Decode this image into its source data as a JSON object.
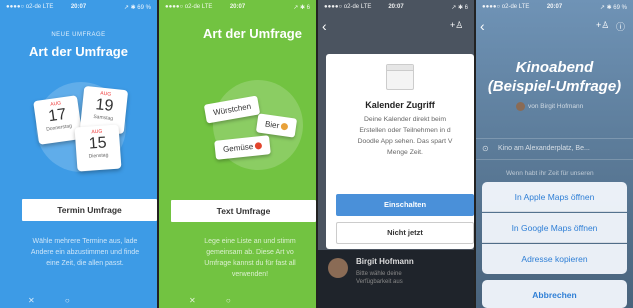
{
  "panel1": {
    "status": {
      "carrier": "●●●●○ o2-de  LTE",
      "time": "20:07",
      "battery": "↗ ✱ 69 %"
    },
    "overline": "NEUE UMFRAGE",
    "title": "Art der Umfrage",
    "cards": [
      {
        "month": "AUG",
        "day": "17",
        "weekday": "Donnerstag"
      },
      {
        "month": "AUG",
        "day": "19",
        "weekday": "Samstag"
      },
      {
        "month": "AUG",
        "day": "15",
        "weekday": "Dienstag"
      }
    ],
    "button": "Termin Umfrage",
    "desc": [
      "Wähle mehrere Termine aus, lade",
      "Andere ein abzustimmen und finde",
      "eine Zeit, die allen passt."
    ],
    "bg_color": "#3d9be6"
  },
  "panel2": {
    "status": {
      "carrier": "●●●●○ o2-de  LTE",
      "time": "20:07",
      "battery": "↗ ✱ 6"
    },
    "title": "Art der Umfrage",
    "tags": [
      "Würstchen",
      "Bier",
      "Gemüse"
    ],
    "button": "Text Umfrage",
    "desc": [
      "Lege eine Liste an und stimm",
      "gemeinsam ab. Diese Art vo",
      "Umfrage kannst du für fast all",
      "verwenden!"
    ],
    "bg_color": "#72c341"
  },
  "panel3": {
    "status": {
      "carrier": "●●●●○ o2-de  LTE",
      "time": "20:07",
      "battery": "↗ ✱ 6"
    },
    "dialog_title": "Kalender Zugriff",
    "dialog_text": [
      "Deine Kalender direkt beim",
      "Erstellen oder Teilnehmen in d",
      "Doodle App sehen. Das spart V",
      "Menge Zeit."
    ],
    "primary": "Einschalten",
    "secondary": "Nicht jetzt",
    "participant_name": "Birgit Hofmann",
    "participant_sub": [
      "Bitte wähle deine",
      "Verfügbarkeit aus"
    ]
  },
  "panel4": {
    "status": {
      "carrier": "●●●●○ o2-de  LTE",
      "time": "20:07",
      "battery": "↗ ✱ 69 %"
    },
    "title_line1": "Kinoabend",
    "title_line2": "(Beispiel-Umfrage)",
    "author": "von Birgit Hofmann",
    "location": "Kino am Alexanderplatz, Be...",
    "subtitle": "Wenn habt ihr Zeit für unseren",
    "actions": [
      "In Apple Maps öffnen",
      "In Google Maps öffnen",
      "Adresse kopieren"
    ],
    "cancel": "Abbrechen"
  }
}
